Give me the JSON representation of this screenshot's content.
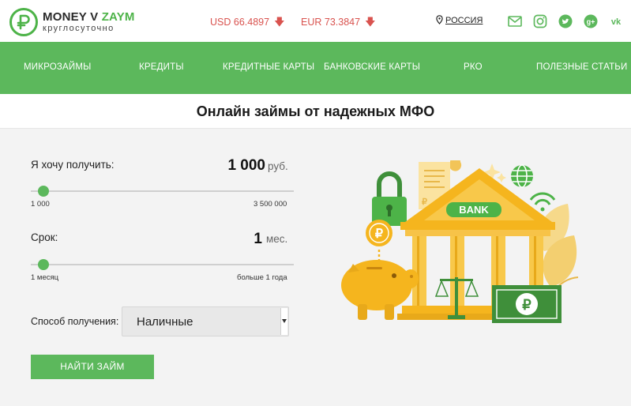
{
  "logo": {
    "name_part1": "MONEY V ",
    "name_part2": "ZAYM",
    "tagline": "круглосуточно"
  },
  "rates": {
    "usd": "USD 66.4897",
    "eur": "EUR 73.3847",
    "arrow": "🡇"
  },
  "region": "РОССИЯ",
  "social": [
    "mail-icon",
    "instagram-icon",
    "twitter-icon",
    "google-plus-icon",
    "vk-icon"
  ],
  "nav": [
    "МИКРОЗАЙМЫ",
    "КРЕДИТЫ",
    "КРЕДИТНЫЕ КАРТЫ",
    "БАНКОВСКИЕ КАРТЫ",
    "РКО",
    "ПОЛЕЗНЫЕ СТАТЬИ"
  ],
  "page_title": "Онлайн займы от надежных МФО",
  "form": {
    "amount": {
      "label": "Я хочу получить:",
      "value": "1 000",
      "unit": "руб.",
      "min": "1 000",
      "max": "3 500 000"
    },
    "term": {
      "label": "Срок:",
      "value": "1",
      "unit": "мес.",
      "min": "1 месяц",
      "max": "больше 1 года"
    },
    "method": {
      "label": "Способ получения:",
      "value": "Наличные"
    },
    "submit": "НАЙТИ ЗАЙМ"
  },
  "illustration": {
    "bank_label": "BANK"
  },
  "colors": {
    "brand_green": "#5cb85c",
    "rate_red": "#d9534f",
    "gold": "#f5b51e"
  }
}
